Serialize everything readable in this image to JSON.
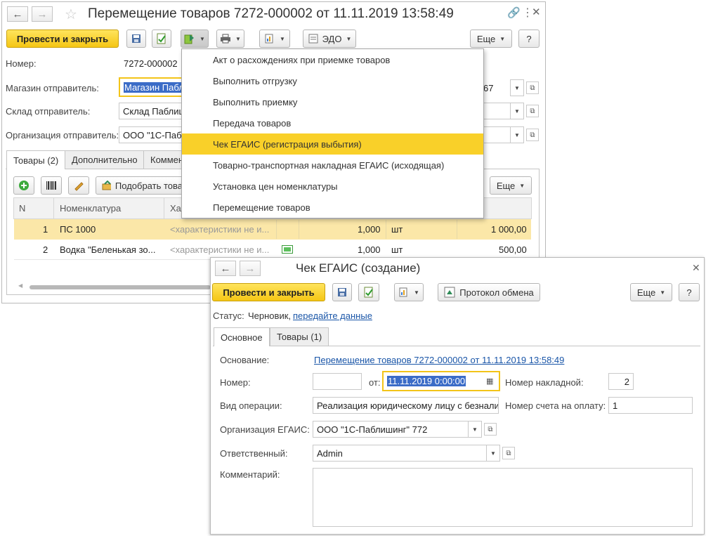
{
  "colors": {
    "accent": "#f5c614",
    "highlight": "#f9d029",
    "row_selected": "#fbe7a8",
    "link": "#1a56a8"
  },
  "main_window": {
    "title": "Перемещение товаров 7272-000002 от 11.11.2019 13:58:49",
    "post_close_label": "Провести и закрыть",
    "edo_label": "ЭДО",
    "more_label": "Еще",
    "help_label": "?",
    "fields": {
      "number_label": "Номер:",
      "number_value": "7272-000002",
      "store_label": "Магазин отправитель:",
      "store_value": "Магазин Пабл",
      "store_tail": "67",
      "warehouse_label": "Склад отправитель:",
      "warehouse_value": "Склад Паблиц",
      "org_label": "Организация отправитель:",
      "org_value": "ООО \"1С-Паблі"
    },
    "tabs": [
      "Товары (2)",
      "Дополнительно",
      "Коммен"
    ],
    "table_toolbar": {
      "pick_label": "Подобрать това",
      "more_label": "Еще"
    },
    "table": {
      "headers": [
        "N",
        "Номенклатура",
        "Ха"
      ],
      "rows": [
        {
          "n": "1",
          "name": "ПС 1000",
          "char": "<характеристики не и...",
          "qty": "1,000",
          "unit": "шт",
          "sum": "1 000,00"
        },
        {
          "n": "2",
          "name": "Водка \"Беленькая зо...",
          "char": "<характеристики не и...",
          "qty": "1,000",
          "unit": "шт",
          "sum": "500,00"
        }
      ]
    },
    "create_menu": [
      "Акт о расхождениях при приемке товаров",
      "Выполнить отгрузку",
      "Выполнить приемку",
      "Передача товаров",
      "Чек ЕГАИС (регистрация выбытия)",
      "Товарно-транспортная накладная ЕГАИС (исходящая)",
      "Установка цен номенклатуры",
      "Перемещение товаров"
    ]
  },
  "egais_window": {
    "title": "Чек ЕГАИС (создание)",
    "post_close_label": "Провести и закрыть",
    "protocol_label": "Протокол обмена",
    "more_label": "Еще",
    "help_label": "?",
    "status_label": "Статус:",
    "status_value": "Черновик,",
    "status_link": "передайте данные",
    "tabs": [
      "Основное",
      "Товары (1)"
    ],
    "form": {
      "basis_label": "Основание:",
      "basis_link": "Перемещение товаров 7272-000002 от 11.11.2019 13:58:49",
      "number_label": "Номер:",
      "number_value": "",
      "from_label": "от:",
      "date_value": "11.11.2019  0:00:00",
      "invoice_label": "Номер накладной:",
      "invoice_value": "2",
      "operation_label": "Вид операции:",
      "operation_value": "Реализация юридическому лицу с безнали",
      "payment_label": "Номер счета на оплату:",
      "payment_value": "1",
      "org_label": "Организация ЕГАИС:",
      "org_value": "ООО \"1С-Паблишинг\" 772",
      "responsible_label": "Ответственный:",
      "responsible_value": "Admin",
      "comment_label": "Комментарий:",
      "comment_value": ""
    }
  }
}
